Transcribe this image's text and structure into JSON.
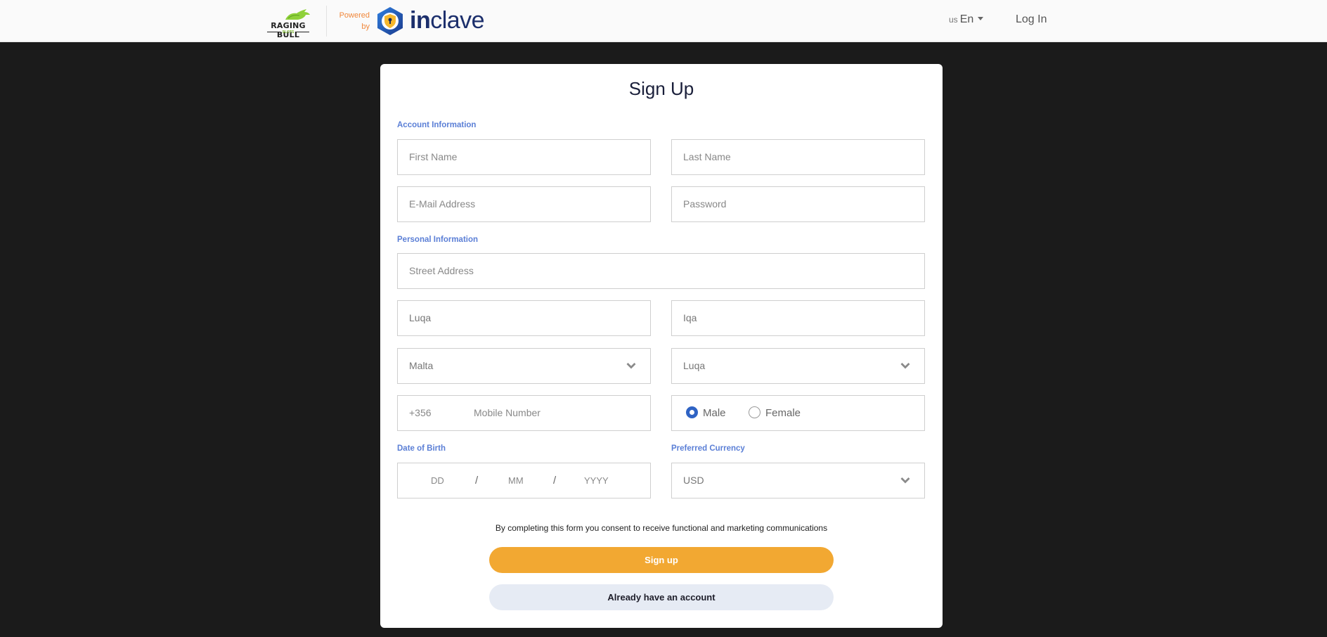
{
  "header": {
    "brand": {
      "name_line1": "RAGING BULL",
      "name_line2": "SLOTS",
      "logo_icon": "bull-icon"
    },
    "powered_by": {
      "line1": "Powered",
      "line2": "by",
      "product_bold": "in",
      "product_rest": "clave",
      "logo_icon": "shield-lock-icon"
    },
    "language": {
      "country_code": "us",
      "label": "En",
      "icon": "caret-down-icon"
    },
    "login_label": "Log In"
  },
  "form": {
    "title": "Sign Up",
    "sections": {
      "account": "Account Information",
      "personal": "Personal Information",
      "dob": "Date of Birth",
      "currency": "Preferred Currency"
    },
    "fields": {
      "first_name": {
        "placeholder": "First Name",
        "value": ""
      },
      "last_name": {
        "placeholder": "Last Name",
        "value": ""
      },
      "email": {
        "placeholder": "E-Mail Address",
        "value": ""
      },
      "password": {
        "placeholder": "Password",
        "value": ""
      },
      "street": {
        "placeholder": "Street Address",
        "value": ""
      },
      "city": {
        "value": "Luqa"
      },
      "locality": {
        "value": "Iqa"
      },
      "country": {
        "value": "Malta",
        "icon": "chevron-down-icon"
      },
      "region": {
        "value": "Luqa",
        "icon": "chevron-down-icon"
      },
      "phone_prefix": "+356",
      "mobile": {
        "placeholder": "Mobile Number",
        "value": ""
      },
      "gender": {
        "options": [
          "Male",
          "Female"
        ],
        "selected": "Male"
      },
      "dob": {
        "day_placeholder": "DD",
        "month_placeholder": "MM",
        "year_placeholder": "YYYY",
        "separator": "/"
      },
      "currency": {
        "value": "USD",
        "icon": "chevron-down-icon"
      }
    },
    "consent_text": "By completing this form you consent to receive functional and marketing communications",
    "signup_label": "Sign up",
    "existing_account_label": "Already have an account"
  },
  "colors": {
    "accent_orange": "#f2a832",
    "section_blue": "#5b7fd6",
    "radio_blue": "#2f63c4",
    "secondary_button": "#e6ebf4",
    "page_background": "#1b1b1b"
  }
}
